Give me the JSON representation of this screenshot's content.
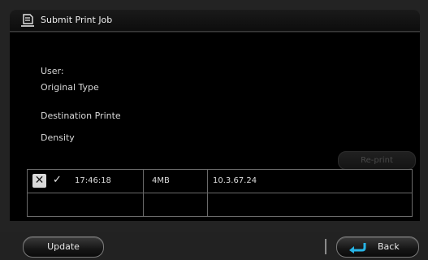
{
  "window": {
    "title": "Submit Print Job"
  },
  "details": {
    "user_label": "User:",
    "original_type_label": "Original Type",
    "destination_label": "Destination Printe",
    "density_label": "Density"
  },
  "actions": {
    "reprint_label": "Re-print",
    "reprint_enabled": false
  },
  "jobs": {
    "rows": [
      {
        "time": "17:46:18",
        "size": "4MB",
        "address": "10.3.67.24"
      },
      {
        "time": "",
        "size": "",
        "address": ""
      }
    ]
  },
  "footer": {
    "update_label": "Update",
    "back_label": "Back"
  },
  "icons": {
    "title": "print-job-icon",
    "delete": "close-icon",
    "status": "checkmark-icon",
    "back": "back-arrow-icon"
  },
  "colors": {
    "back_arrow": "#27b4e6",
    "disabled_text": "#4a4a4a"
  }
}
